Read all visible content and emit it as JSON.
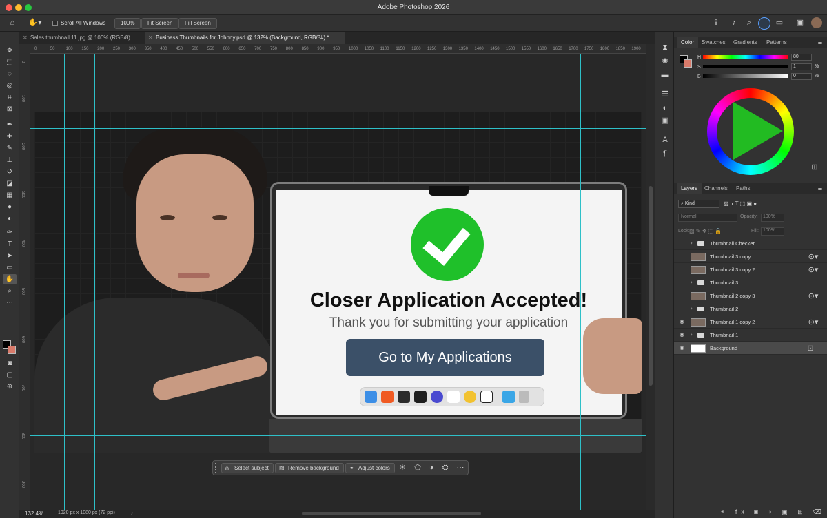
{
  "app": {
    "title": "Adobe Photoshop 2026"
  },
  "options_bar": {
    "scroll_all_windows": "Scroll All Windows",
    "zoom": "100%",
    "fit_screen": "Fit Screen",
    "fill_screen": "Fill Screen"
  },
  "tabs": [
    {
      "label": "Sales thumbnail 11.jpg @ 100% (RGB/8)"
    },
    {
      "label": "Business Thumbnails for Johnny.psd @ 132% (Background, RGB/8#) *"
    }
  ],
  "ruler": {
    "h": [
      "0",
      "50",
      "100",
      "150",
      "200",
      "250",
      "300",
      "350",
      "400",
      "450",
      "500",
      "550",
      "600",
      "650",
      "700",
      "750",
      "800",
      "850",
      "900",
      "950",
      "1000",
      "1050",
      "1100",
      "1150",
      "1200",
      "1250",
      "1300",
      "1350",
      "1400",
      "1450",
      "1500",
      "1550",
      "1600",
      "1650",
      "1700",
      "1750",
      "1800",
      "1850",
      "1900"
    ]
  },
  "canvas": {
    "headline": "Closer Application Accepted!",
    "subtext": "Thank you for submitting your application",
    "cta": "Go to My Applications"
  },
  "context_bar": {
    "select_subject": "Select subject",
    "remove_background": "Remove background",
    "adjust_colors": "Adjust colors"
  },
  "status": {
    "zoom": "132.4%",
    "doc_info": "1920 px x 1080 px (72 ppi)"
  },
  "color_panel": {
    "tabs": [
      "Color",
      "Swatches",
      "Gradients",
      "Patterns"
    ],
    "h_label": "H",
    "s_label": "S",
    "b_label": "B",
    "h": "80",
    "s": "1",
    "b": "0",
    "pct": "%"
  },
  "layers_panel": {
    "tabs": [
      "Layers",
      "Channels",
      "Paths"
    ],
    "kind": "Kind",
    "blend": "Normal",
    "opacity_label": "Opacity:",
    "opacity": "100%",
    "lock_label": "Lock:",
    "fill_label": "Fill:",
    "fill": "100%",
    "layers": [
      {
        "name": "Thumbnail Checker"
      },
      {
        "name": "Thumbnail 3 copy"
      },
      {
        "name": "Thumbnail 3 copy 2"
      },
      {
        "name": "Thumbnail 3"
      },
      {
        "name": "Thumbnail 2 copy 3"
      },
      {
        "name": "Thumbnail 2"
      },
      {
        "name": "Thumbnail 1 copy 2"
      },
      {
        "name": "Thumbnail 1"
      },
      {
        "name": "Background"
      }
    ]
  },
  "colors": {
    "accent": "#2ec0c8",
    "cta": "#3b5068",
    "check": "#1fc02a"
  }
}
